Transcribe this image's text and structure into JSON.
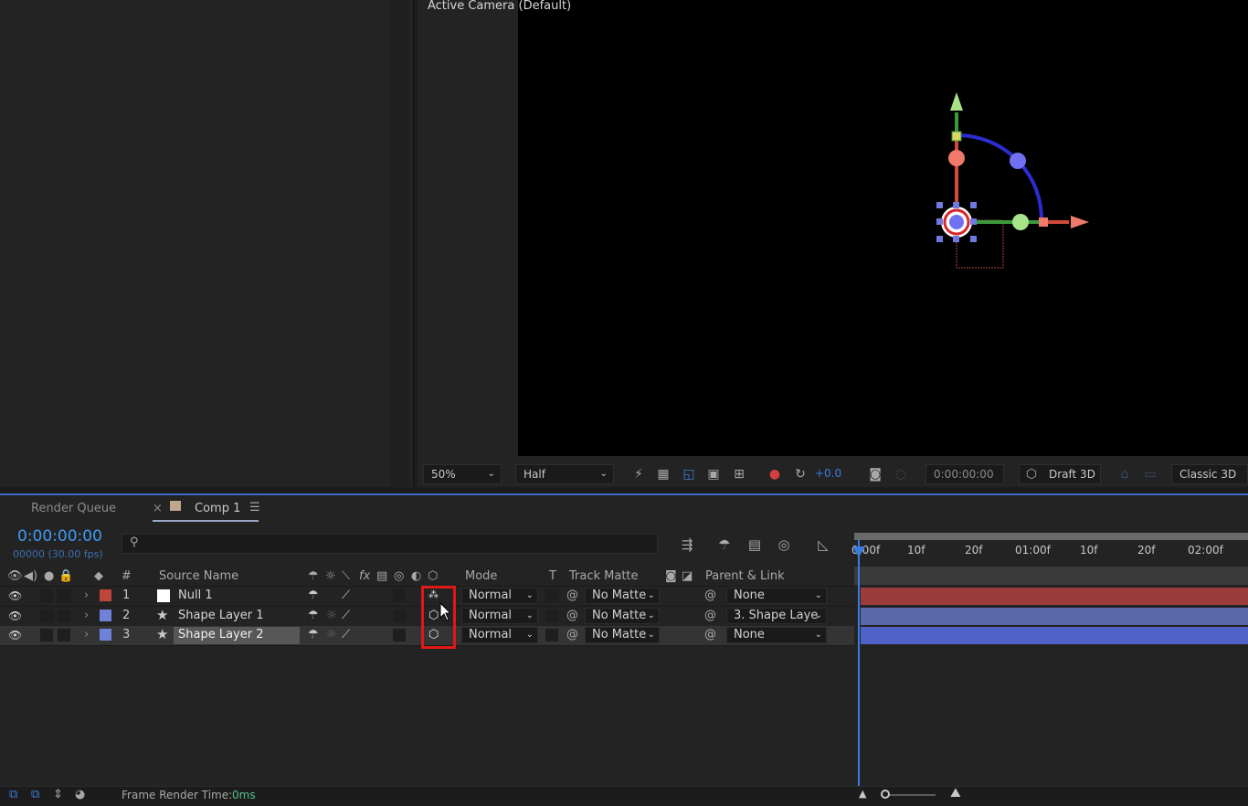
{
  "viewer": {
    "title": "Active Camera (Default)",
    "zoom": "50%",
    "resolution": "Half",
    "exposure": "+0.0",
    "timecode": "0:00:00:00",
    "renderer": "Draft 3D",
    "view_mode": "Classic 3D"
  },
  "timeline": {
    "render_queue_tab": "Render Queue",
    "tab_close": "×",
    "comp_tab": "Comp 1",
    "tab_menu": "☰",
    "timecode": "0:00:00:00",
    "frame_info": "00000 (30.00 fps)",
    "search_placeholder": "",
    "columns": {
      "hash": "#",
      "source_name": "Source Name",
      "fx": "fx",
      "mode": "Mode",
      "t": "T",
      "track_matte": "Track Matte",
      "parent_link": "Parent & Link"
    },
    "layers": [
      {
        "num": "1",
        "name": "Null 1",
        "mode": "Normal",
        "track_matte": "No Matte",
        "parent": "None",
        "label_color": "#c0453a",
        "bar_color": "#9b3b3b"
      },
      {
        "num": "2",
        "name": "Shape Layer 1",
        "mode": "Normal",
        "track_matte": "No Matte",
        "parent": "3. Shape Laye",
        "label_color": "#6f82d8",
        "bar_color": "#5a67a8"
      },
      {
        "num": "3",
        "name": "Shape Layer 2",
        "mode": "Normal",
        "track_matte": "No Matte",
        "parent": "None",
        "label_color": "#6f82d8",
        "bar_color": "#4e62c8"
      }
    ],
    "ruler_ticks": [
      "0:00f",
      "10f",
      "20f",
      "01:00f",
      "10f",
      "20f",
      "02:00f"
    ],
    "status": {
      "render_time_label": "Frame Render Time:",
      "render_time_value": "0ms"
    }
  },
  "colors": {
    "accent": "#3d9bf0",
    "highlight": "#e01818"
  }
}
